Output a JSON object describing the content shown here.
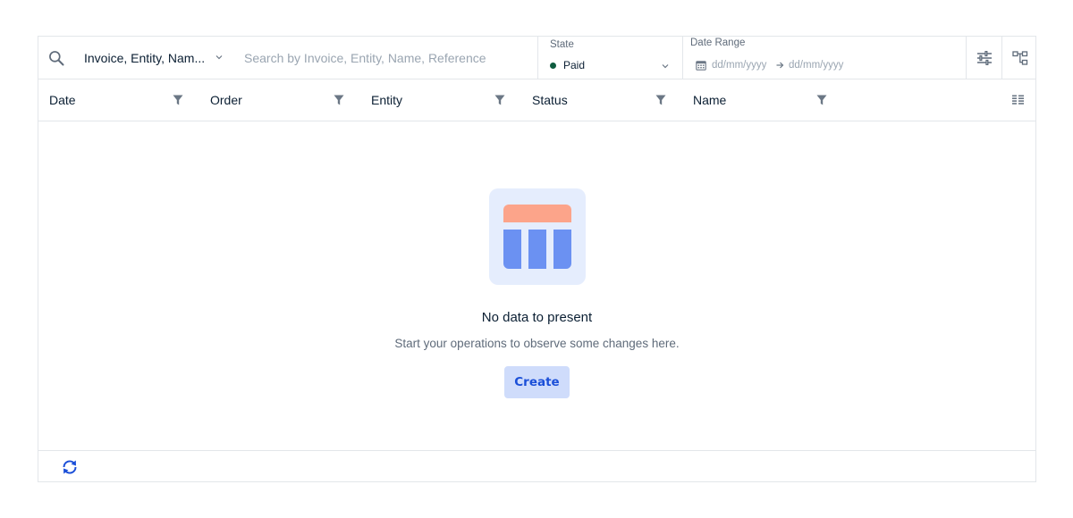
{
  "toolbar": {
    "search_icon": "search-icon",
    "selector_label": "Invoice, Entity, Nam...",
    "search_placeholder": "Search by Invoice, Entity, Name, Reference",
    "state": {
      "label": "State",
      "value": "Paid",
      "dot_color": "#0f5c3f"
    },
    "date_range": {
      "label": "Date Range",
      "from_placeholder": "dd/mm/yyyy",
      "to_placeholder": "dd/mm/yyyy"
    },
    "buttons": [
      "sliders-icon",
      "tree-structure-icon"
    ]
  },
  "table": {
    "columns": [
      {
        "label": "Date"
      },
      {
        "label": "Order"
      },
      {
        "label": "Entity"
      },
      {
        "label": "Status"
      },
      {
        "label": "Name"
      }
    ],
    "column_settings_icon": "column-settings-icon"
  },
  "empty_state": {
    "title": "No data to present",
    "description": "Start your operations to observe some changes here.",
    "button_label": "Create",
    "icon": "table-icon"
  },
  "footer": {
    "refresh_icon": "refresh-icon"
  },
  "colors": {
    "accent": "#1b4fd8",
    "border": "#e3e6ea",
    "icon_gray": "#6b7785",
    "empty_icon_bg": "#e5edfd",
    "empty_icon_header": "#fca48a",
    "empty_icon_columns": "#6b91f2"
  }
}
